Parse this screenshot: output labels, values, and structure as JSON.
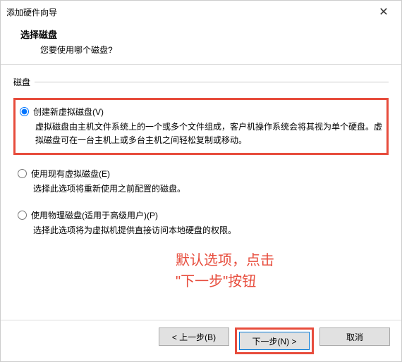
{
  "titlebar": {
    "title": "添加硬件向导",
    "close": "✕"
  },
  "header": {
    "title": "选择磁盘",
    "subtitle": "您要使用哪个磁盘?"
  },
  "group": {
    "label": "磁盘"
  },
  "options": [
    {
      "label": "创建新虚拟磁盘(V)",
      "desc": "虚拟磁盘由主机文件系统上的一个或多个文件组成，客户机操作系统会将其视为单个硬盘。虚拟磁盘可在一台主机上或多台主机之间轻松复制或移动。",
      "selected": true
    },
    {
      "label": "使用现有虚拟磁盘(E)",
      "desc": "选择此选项将重新使用之前配置的磁盘。",
      "selected": false
    },
    {
      "label": "使用物理磁盘(适用于高级用户)(P)",
      "desc": "选择此选项将为虚拟机提供直接访问本地硬盘的权限。",
      "selected": false
    }
  ],
  "annotation": {
    "line1": "默认选项，点击",
    "line2": "\"下一步\"按钮"
  },
  "buttons": {
    "back": "< 上一步(B)",
    "next": "下一步(N) >",
    "cancel": "取消"
  },
  "colors": {
    "highlight": "#e74c3c"
  }
}
